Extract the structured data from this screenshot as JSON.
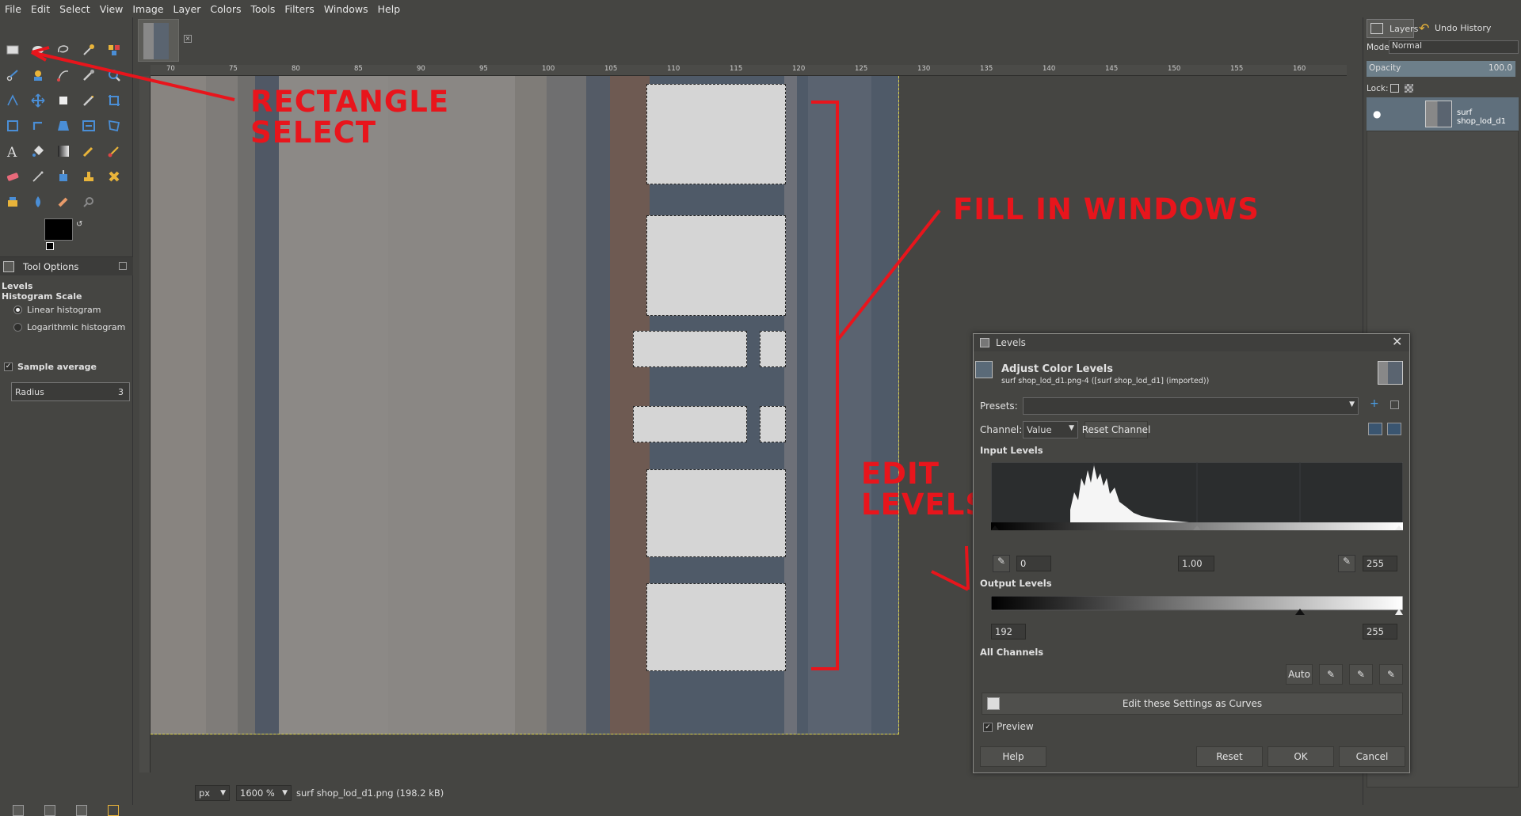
{
  "menubar": {
    "items": [
      "File",
      "Edit",
      "Select",
      "View",
      "Image",
      "Layer",
      "Colors",
      "Tools",
      "Filters",
      "Windows",
      "Help"
    ]
  },
  "toolbox": {
    "tool_options_tab": "Tool Options",
    "options_title": "Levels",
    "histogram_scale_label": "Histogram Scale",
    "linear_label": "Linear histogram",
    "log_label": "Logarithmic histogram",
    "sample_average_label": "Sample average",
    "radius_label": "Radius",
    "radius_value": "3"
  },
  "ruler": {
    "top_ticks": [
      "70",
      "75",
      "80",
      "85",
      "90",
      "95",
      "100",
      "105",
      "110",
      "115",
      "120",
      "125",
      "130",
      "135",
      "140",
      "145",
      "150",
      "155",
      "160"
    ]
  },
  "annotations": {
    "rectangle_select": "RECTANGLE SELECT",
    "fill_in_windows": "FILL IN WINDOWS",
    "edit_levels": "EDIT LEVELS",
    "color": "#e8151c"
  },
  "status_bar": {
    "unit": "px",
    "zoom": "1600 %",
    "file_info": "surf shop_lod_d1.png (198.2 kB)"
  },
  "dock": {
    "tab_layers": "Layers",
    "tab_undo": "Undo History",
    "mode_label": "Mode:",
    "mode_value": "Normal",
    "opacity_label": "Opacity",
    "opacity_value": "100.0",
    "lock_label": "Lock:",
    "layer_name": "surf shop_lod_d1"
  },
  "levels_dialog": {
    "window_title": "Levels",
    "header_title": "Adjust Color Levels",
    "header_subtitle": "surf shop_lod_d1.png-4 ([surf shop_lod_d1] (imported))",
    "presets_label": "Presets:",
    "presets_value": "",
    "channel_label": "Channel:",
    "channel_value": "Value",
    "reset_channel": "Reset Channel",
    "input_levels_label": "Input Levels",
    "input_low": "0",
    "input_gamma": "1.00",
    "input_high": "255",
    "output_levels_label": "Output Levels",
    "output_low": "192",
    "output_high": "255",
    "all_channels_label": "All Channels",
    "auto_button": "Auto",
    "edit_as_curves": "Edit these Settings as Curves",
    "preview_label": "Preview",
    "help_button": "Help",
    "reset_button": "Reset",
    "ok_button": "OK",
    "cancel_button": "Cancel"
  }
}
